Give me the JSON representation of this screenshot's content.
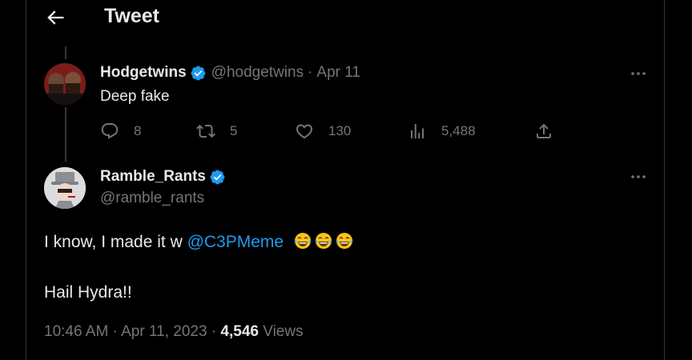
{
  "header": {
    "title": "Tweet"
  },
  "parent_tweet": {
    "name": "Hodgetwins",
    "handle": "@hodgetwins",
    "separator": "·",
    "date": "Apr 11",
    "text": "Deep fake",
    "replies": "8",
    "retweets": "5",
    "likes": "130",
    "views": "5,488"
  },
  "main_tweet": {
    "name": "Ramble_Rants",
    "handle": "@ramble_rants",
    "text_prefix": "I know, I made it w ",
    "mention": "@C3PMeme",
    "emojis": [
      "laughing-tears",
      "laughing-tears",
      "laughing-tears"
    ],
    "text_line2": "Hail Hydra!!",
    "time": "10:46 AM",
    "separator": "·",
    "date": "Apr 11, 2023",
    "views_count": "4,546",
    "views_label": "Views"
  },
  "colors": {
    "accent": "#1d9bf0",
    "muted": "#71767b",
    "text": "#e7e9ea",
    "background": "#000000"
  }
}
